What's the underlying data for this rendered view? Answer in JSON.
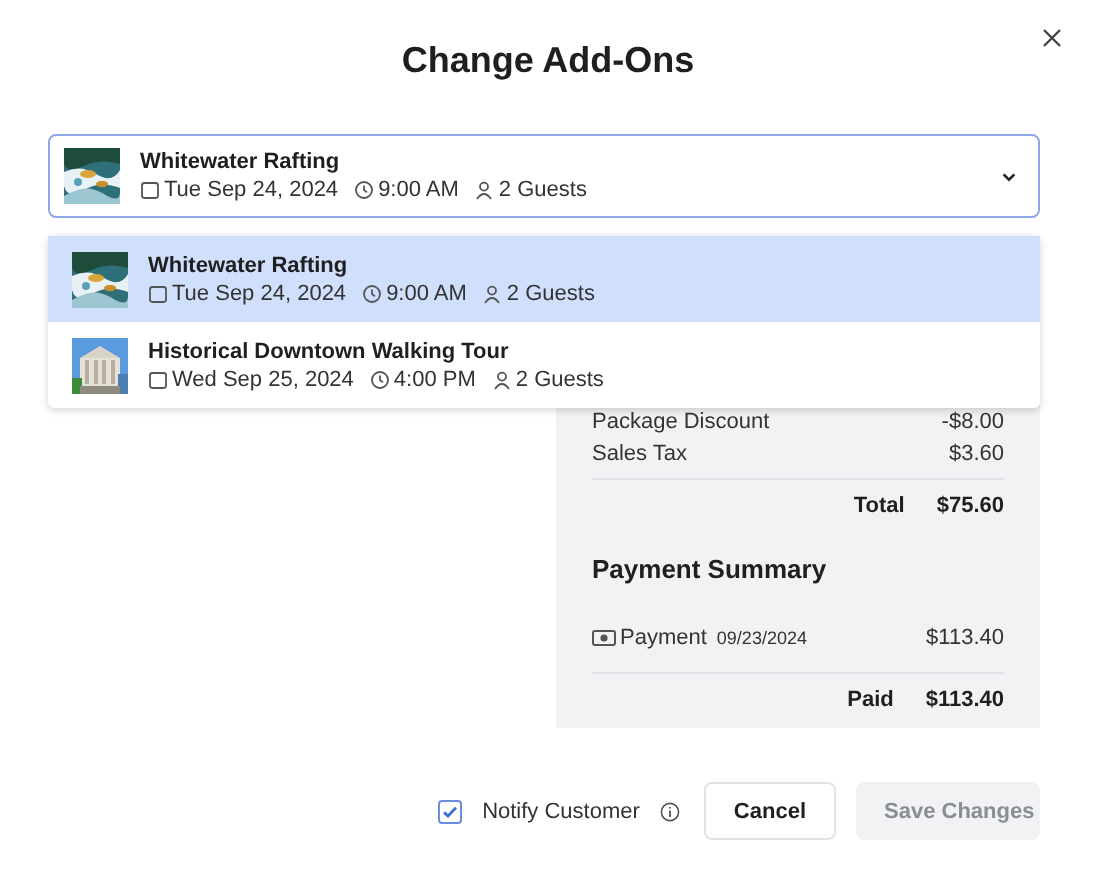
{
  "dialog": {
    "title": "Change Add-Ons"
  },
  "selector": {
    "name": "Whitewater Rafting",
    "date": "Tue Sep 24, 2024",
    "time": "9:00 AM",
    "guests": "2 Guests",
    "kind": "water"
  },
  "options": [
    {
      "name": "Whitewater Rafting",
      "date": "Tue Sep 24, 2024",
      "time": "9:00 AM",
      "guests": "2 Guests",
      "kind": "water",
      "selected": true
    },
    {
      "name": "Historical Downtown Walking Tour",
      "date": "Wed Sep 25, 2024",
      "time": "4:00 PM",
      "guests": "2 Guests",
      "kind": "building",
      "selected": false
    }
  ],
  "summary": {
    "lines": [
      {
        "label": "Package Discount",
        "amount": "-$8.00"
      },
      {
        "label": "Sales Tax",
        "amount": "$3.60"
      }
    ],
    "total": {
      "label": "Total",
      "amount": "$75.60"
    },
    "payment_title": "Payment Summary",
    "payments": [
      {
        "label": "Payment",
        "date": "09/23/2024",
        "amount": "$113.40"
      }
    ],
    "paid": {
      "label": "Paid",
      "amount": "$113.40"
    }
  },
  "footer": {
    "notify": {
      "label": "Notify Customer",
      "checked": true
    },
    "cancel": "Cancel",
    "save": {
      "label": "Save Changes",
      "disabled": true
    }
  }
}
